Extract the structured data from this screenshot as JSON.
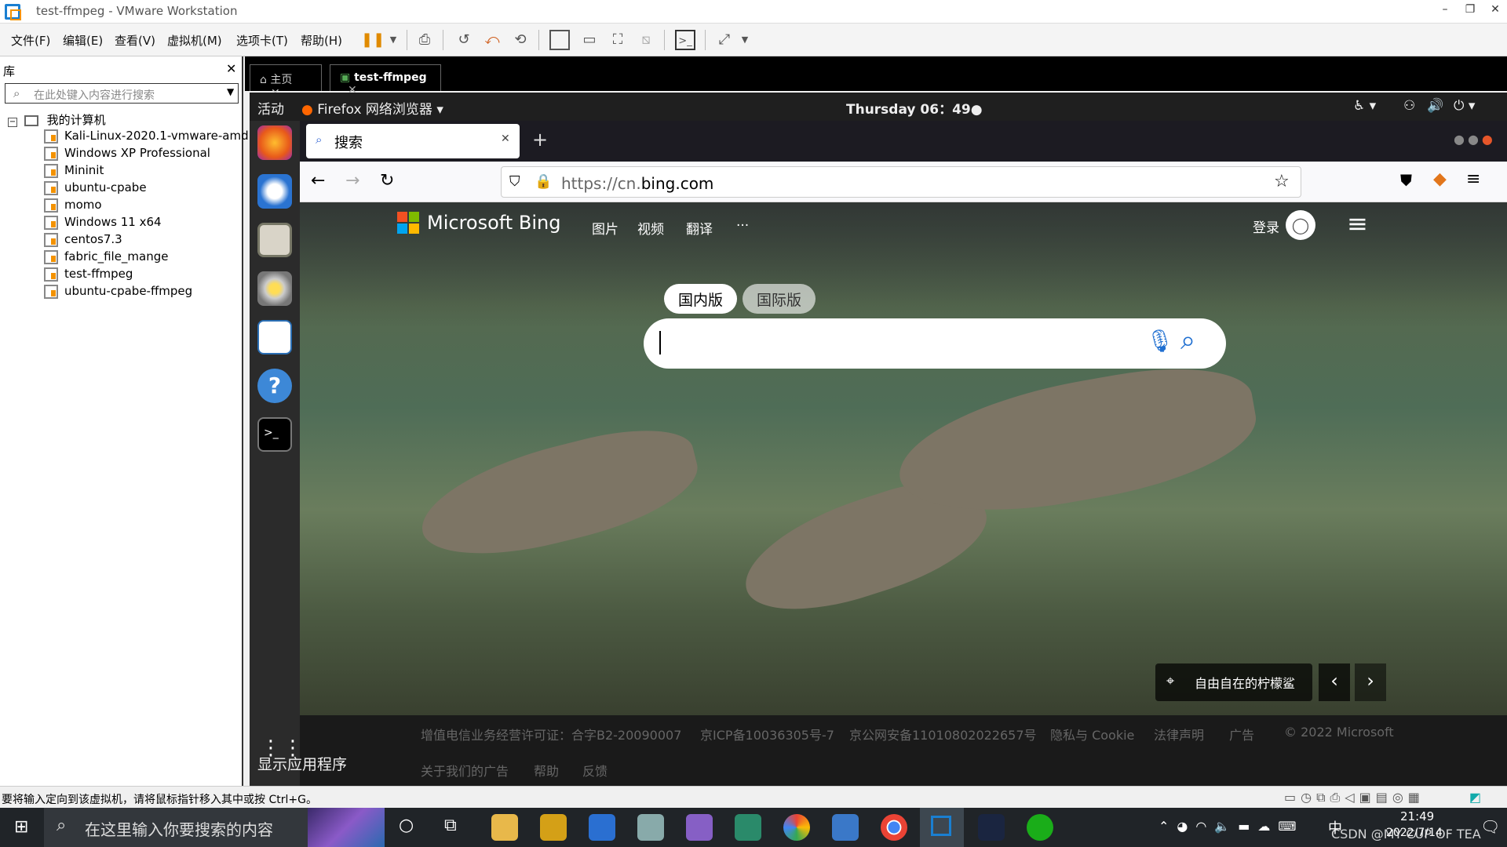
{
  "window": {
    "title": "test-ffmpeg - VMware Workstation",
    "controls": {
      "minimize": "–",
      "restore": "❐",
      "close": "✕"
    }
  },
  "menubar": {
    "items": [
      "文件(F)",
      "编辑(E)",
      "查看(V)",
      "虚拟机(M)",
      "选项卡(T)",
      "帮助(H)"
    ]
  },
  "library": {
    "title": "库",
    "search_placeholder": "在此处键入内容进行搜索",
    "root": "我的计算机",
    "vms": [
      "Kali-Linux-2020.1-vmware-amd",
      "Windows XP Professional",
      "Mininit",
      "ubuntu-cpabe",
      "momo",
      "Windows 11 x64",
      "centos7.3",
      "fabric_file_mange",
      "test-ffmpeg",
      "ubuntu-cpabe-ffmpeg"
    ]
  },
  "vm_tabs": [
    {
      "label": "主页"
    },
    {
      "label": "test-ffmpeg"
    }
  ],
  "ubuntu": {
    "activities": "活动",
    "app_menu": "Firefox 网络浏览器",
    "clock": "Thursday 06：49●",
    "show_apps": "显示应用程序"
  },
  "firefox": {
    "tab_title": "搜索",
    "url_prefix": "https://cn.",
    "url_domain": "bing.com"
  },
  "bing": {
    "brand": "Microsoft Bing",
    "nav": [
      "图片",
      "视频",
      "翻译",
      "···"
    ],
    "signin": "登录",
    "scope": {
      "domestic": "国内版",
      "international": "国际版"
    },
    "caption": "自由自在的柠檬鲨",
    "footer_row1": [
      "增值电信业务经营许可证：合字B2-20090007",
      "京ICP备10036305号-7",
      "京公网安备11010802022657号",
      "隐私与 Cookie",
      "法律声明",
      "广告",
      "© 2022 Microsoft"
    ],
    "footer_row2": [
      "关于我们的广告",
      "帮助",
      "反馈"
    ]
  },
  "statusbar": {
    "message": "要将输入定向到该虚拟机，请将鼠标指针移入其中或按 Ctrl+G。"
  },
  "taskbar": {
    "search_placeholder": "在这里输入你要搜索的内容",
    "ime": "中",
    "time": "21:49",
    "date": "2022/7/14",
    "overlay": "CSDN @MY CUP OF TEA"
  }
}
